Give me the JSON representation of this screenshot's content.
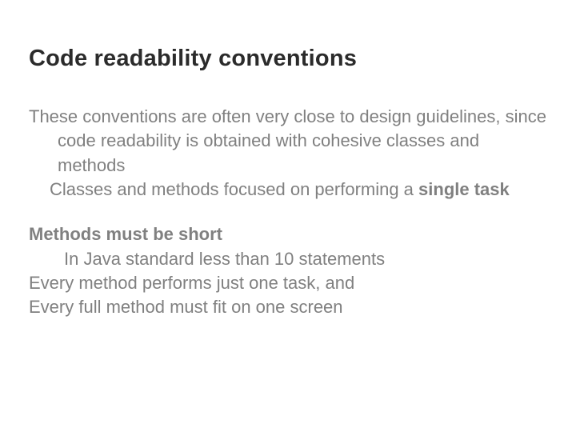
{
  "title": "Code readability conventions",
  "para1_a": "These conventions are often very close to design guidelines, since code readability is obtained with cohesive classes and methods",
  "para2_a": "Classes and methods focused on performing a ",
  "para2_b": "single task",
  "para3": "Methods must be short",
  "para4": "In Java standard less than 10 statements",
  "para5": "Every method performs just one task, and",
  "para6": "Every full method must fit on one screen"
}
